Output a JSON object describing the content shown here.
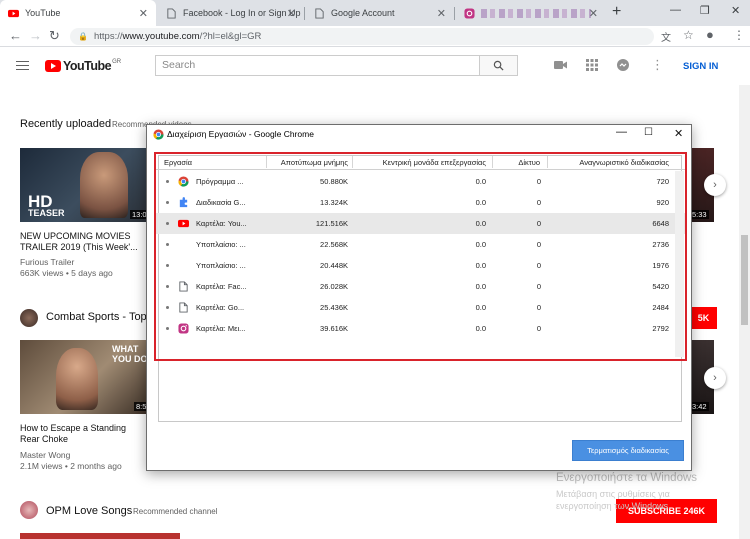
{
  "browser": {
    "tabs": [
      {
        "title": "YouTube",
        "active": true
      },
      {
        "title": "Facebook - Log In or Sign Up",
        "active": false
      },
      {
        "title": "Google Account",
        "active": false
      },
      {
        "title": "",
        "active": false
      }
    ],
    "url_scheme": "https://",
    "url_host": "www.youtube.com",
    "url_path": "/?hl=el&gl=GR"
  },
  "youtube": {
    "logo_text": "YouTube",
    "country_code": "GR",
    "search_placeholder": "Search",
    "sign_in": "SIGN IN",
    "shelves": [
      {
        "title": "Recently uploaded",
        "subtitle": "Recommended videos",
        "video": {
          "title": "NEW UPCOMING MOVIES TRAILER 2019 (This Week'...",
          "channel": "Furious Trailer",
          "meta": "663K views • 5 days ago",
          "thumb_text_1": "HD",
          "thumb_text_2": "TEASER",
          "duration": "13:0"
        },
        "right_duration": "5:33"
      },
      {
        "title": "Combat Sports - Topic",
        "subscribe": "5K",
        "video": {
          "title": "How to Escape a Standing Rear Choke",
          "channel": "Master Wong",
          "meta": "2.1M views • 2 months ago",
          "thumb_text_1": "WHAT",
          "thumb_text_2": "YOU DO",
          "duration": "8:5"
        },
        "right_duration": "3:42"
      },
      {
        "title": "OPM Love Songs",
        "subtitle": "Recommended channel",
        "subscribe": "SUBSCRIBE  246K"
      }
    ]
  },
  "watermark": {
    "line1": "Ενεργοποιήστε τα Windows",
    "line2": "Μετάβαση στις ρυθμίσεις για ενεργοποίηση των Windows."
  },
  "task_manager": {
    "title": "Διαχείριση Εργασιών - Google Chrome",
    "columns": [
      "Εργασία",
      "Αποτύπωμα μνήμης",
      "Κεντρική μονάδα επεξεργασίας",
      "Δίκτυο",
      "Αναγνωριστικό διαδικασίας"
    ],
    "rows": [
      {
        "task": "Πρόγραμμα ...",
        "memory": "50.880K",
        "cpu": "0.0",
        "network": "0",
        "pid": "720",
        "icon": "chrome-icon",
        "selected": false
      },
      {
        "task": "Διαδικασία G...",
        "memory": "13.324K",
        "cpu": "0.0",
        "network": "0",
        "pid": "920",
        "icon": "puzzle-icon",
        "selected": false
      },
      {
        "task": "Καρτέλα: You...",
        "memory": "121.516K",
        "cpu": "0.0",
        "network": "0",
        "pid": "6648",
        "icon": "youtube-icon",
        "selected": true
      },
      {
        "task": "Υποπλαίσιο: ...",
        "memory": "22.568K",
        "cpu": "0.0",
        "network": "0",
        "pid": "2736",
        "icon": "",
        "selected": false
      },
      {
        "task": "Υποπλαίσιο: ...",
        "memory": "20.448K",
        "cpu": "0.0",
        "network": "0",
        "pid": "1976",
        "icon": "",
        "selected": false
      },
      {
        "task": "Καρτέλα: Fac...",
        "memory": "26.028K",
        "cpu": "0.0",
        "network": "0",
        "pid": "5420",
        "icon": "page-icon",
        "selected": false
      },
      {
        "task": "Καρτέλα: Go...",
        "memory": "25.436K",
        "cpu": "0.0",
        "network": "0",
        "pid": "2484",
        "icon": "page-icon",
        "selected": false
      },
      {
        "task": "Καρτέλα: Mει...",
        "memory": "39.616K",
        "cpu": "0.0",
        "network": "0",
        "pid": "2792",
        "icon": "instagram-icon",
        "selected": false
      }
    ],
    "end_process": "Τερματισμός διαδικασίας"
  },
  "colors": {
    "youtube_red": "#ff0000",
    "highlight_red": "#d9232b",
    "button_blue": "#4a90e2",
    "link_blue": "#065fd4"
  }
}
